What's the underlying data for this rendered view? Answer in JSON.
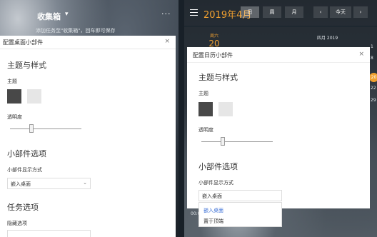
{
  "left_widget": {
    "title": "收集箱",
    "caret": "▾",
    "more": "···",
    "hint": "添加任务至\"收集箱\"，回车即可保存"
  },
  "left_panel": {
    "title": "配置桌面小部件",
    "close": "×",
    "theme_section": "主题与样式",
    "theme_label": "主题",
    "opacity_label": "透明度",
    "widget_section": "小部件选项",
    "display_mode_label": "小部件显示方式",
    "display_mode_value": "嵌入桌面",
    "task_section": "任务选项",
    "task_label": "隐藏选项",
    "colors": {
      "dark_swatch": "#484848",
      "light_swatch": "#e6e6e6"
    }
  },
  "calendar": {
    "month_title": "2019年4月",
    "view_buttons": [
      "日",
      "周",
      "月",
      "今天"
    ],
    "weekday": "周六",
    "day_number": "20",
    "mini_calendar_title": "四月 2019",
    "today_marker": "20",
    "mini_numbers": [
      "1",
      "8",
      "15",
      "22",
      "29"
    ],
    "bottom_text": "00:00",
    "accent_color": "#f0a030"
  },
  "right_panel": {
    "title": "配置日历小部件",
    "close": "×",
    "theme_section": "主题与样式",
    "theme_label": "主题",
    "opacity_label": "透明度",
    "widget_section": "小部件选项",
    "display_mode_label": "小部件显示方式",
    "display_mode_value": "嵌入桌面",
    "dropdown_options": [
      "嵌入桌面",
      "置于顶端"
    ],
    "dropdown_selected": "嵌入桌面",
    "selected_color": "#3b6fd6"
  }
}
